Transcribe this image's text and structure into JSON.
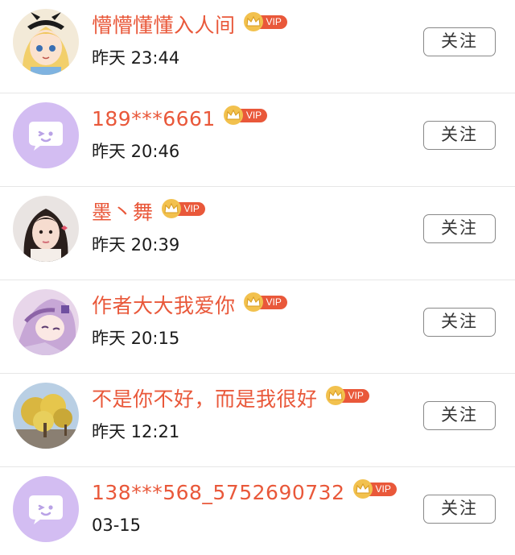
{
  "users": [
    {
      "name": "懵懵懂懂入人间",
      "time": "昨天 23:44",
      "vip_label": "VIP",
      "avatar": "cartoon-girl-avatar",
      "follow_label": "关注"
    },
    {
      "name": "189***6661",
      "time": "昨天 20:46",
      "vip_label": "VIP",
      "avatar": "default-chat-avatar",
      "follow_label": "关注"
    },
    {
      "name": "墨丶舞",
      "time": "昨天 20:39",
      "vip_label": "VIP",
      "avatar": "girl-photo-avatar",
      "follow_label": "关注"
    },
    {
      "name": "作者大大我爱你",
      "time": "昨天 20:15",
      "vip_label": "VIP",
      "avatar": "anime-girl-avatar",
      "follow_label": "关注"
    },
    {
      "name": "不是你不好，而是我很好",
      "time": "昨天 12:21",
      "vip_label": "VIP",
      "avatar": "tree-photo-avatar",
      "follow_label": "关注"
    },
    {
      "name": "138***568_5752690732",
      "time": "03-15",
      "vip_label": "VIP",
      "avatar": "default-chat-avatar",
      "follow_label": "关注"
    }
  ],
  "colors": {
    "name": "#e9583a",
    "vip_tag": "#e9583a",
    "crown": "#f2c14e",
    "default_avatar": "#d3bdf2"
  }
}
